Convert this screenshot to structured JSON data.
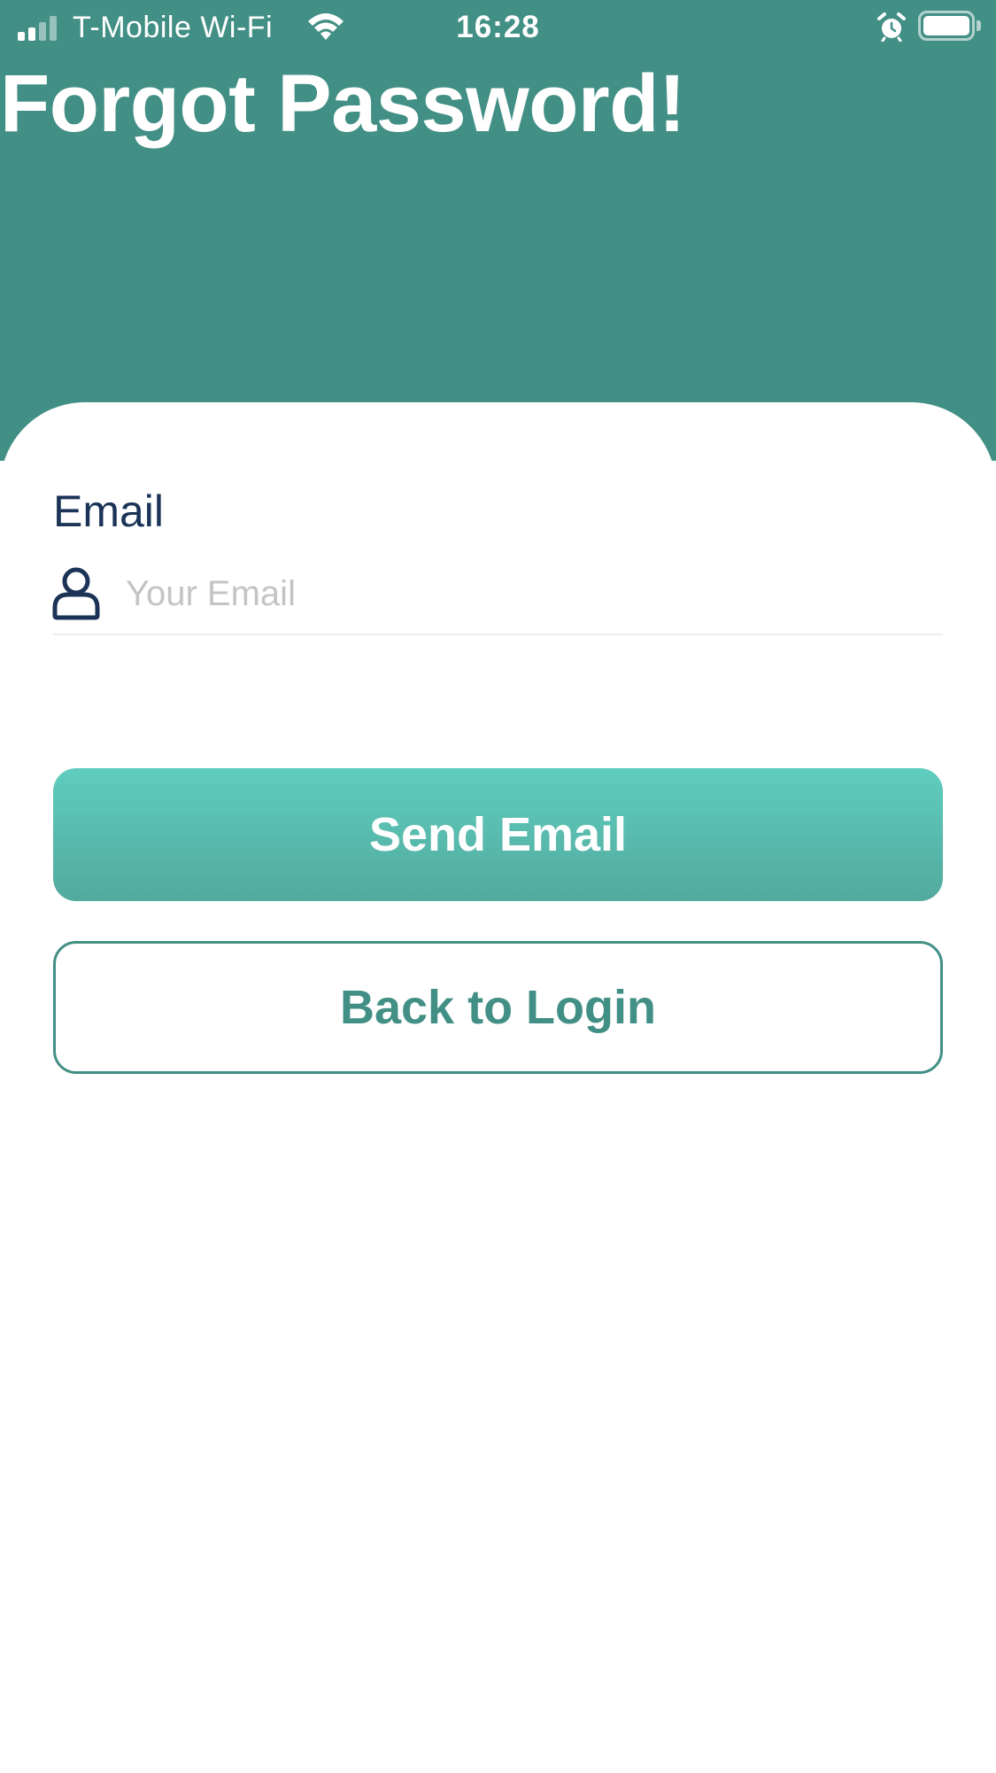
{
  "status_bar": {
    "carrier": "T-Mobile Wi-Fi",
    "time": "16:28",
    "icons": [
      "signal-icon",
      "wifi-icon",
      "alarm-icon",
      "battery-icon"
    ]
  },
  "header": {
    "title": "Forgot Password!"
  },
  "form": {
    "email_label": "Email",
    "email_value": "",
    "email_placeholder": "Your Email",
    "field_icon": "user-icon"
  },
  "actions": {
    "send_label": "Send Email",
    "back_label": "Back to Login"
  },
  "colors": {
    "header_bg": "#428f85",
    "accent": "#5fcdbf",
    "label_text": "#1a3356",
    "placeholder": "#c4c4c6"
  }
}
